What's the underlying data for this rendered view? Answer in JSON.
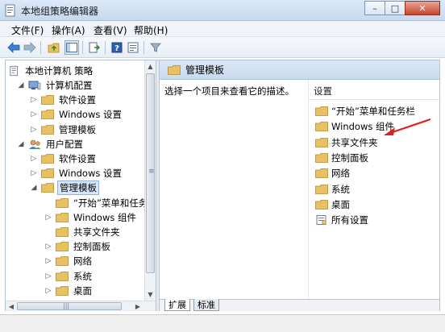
{
  "window": {
    "title": "本地组策略编辑器",
    "minimize": "–",
    "maximize": "□",
    "close": "✕"
  },
  "menu": [
    {
      "label": "文件(F)"
    },
    {
      "label": "操作(A)"
    },
    {
      "label": "查看(V)"
    },
    {
      "label": "帮助(H)"
    }
  ],
  "toolbar": {
    "items": [
      "back-arrow-icon",
      "forward-arrow-icon",
      "up-folder-icon",
      "show-hide-tree-icon",
      "export-list-icon",
      "help-icon",
      "properties-icon",
      "filter-icon"
    ]
  },
  "tree": {
    "root": "本地计算机 策略",
    "nodes": [
      {
        "label": "计算机配置",
        "depth": 1,
        "expander": "◢",
        "icon": "computer-icon"
      },
      {
        "label": "软件设置",
        "depth": 2,
        "expander": "▷",
        "icon": "folder-icon"
      },
      {
        "label": "Windows 设置",
        "depth": 2,
        "expander": "▷",
        "icon": "folder-icon"
      },
      {
        "label": "管理模板",
        "depth": 2,
        "expander": "▷",
        "icon": "folder-icon"
      },
      {
        "label": "用户配置",
        "depth": 1,
        "expander": "◢",
        "icon": "user-icon"
      },
      {
        "label": "软件设置",
        "depth": 2,
        "expander": "▷",
        "icon": "folder-icon"
      },
      {
        "label": "Windows 设置",
        "depth": 2,
        "expander": "▷",
        "icon": "folder-icon"
      },
      {
        "label": "管理模板",
        "depth": 2,
        "expander": "◢",
        "icon": "folder-icon",
        "selected": true
      },
      {
        "label": "“开始”菜单和任务",
        "depth": 3,
        "expander": "",
        "icon": "folder-icon"
      },
      {
        "label": "Windows 组件",
        "depth": 3,
        "expander": "▷",
        "icon": "folder-icon"
      },
      {
        "label": "共享文件夹",
        "depth": 3,
        "expander": "",
        "icon": "folder-icon"
      },
      {
        "label": "控制面板",
        "depth": 3,
        "expander": "▷",
        "icon": "folder-icon"
      },
      {
        "label": "网络",
        "depth": 3,
        "expander": "▷",
        "icon": "folder-icon"
      },
      {
        "label": "系统",
        "depth": 3,
        "expander": "▷",
        "icon": "folder-icon"
      },
      {
        "label": "桌面",
        "depth": 3,
        "expander": "▷",
        "icon": "folder-icon"
      }
    ]
  },
  "scroll": {
    "up": "▲",
    "down": "▼",
    "left": "◀",
    "right": "▶",
    "grip": "≡",
    "hgrip": "|||"
  },
  "detail": {
    "header": "管理模板",
    "description": "选择一个项目来查看它的描述。",
    "column": "设置",
    "items": [
      {
        "label": "“开始”菜单和任务栏",
        "icon": "folder-icon"
      },
      {
        "label": "Windows 组件",
        "icon": "folder-icon"
      },
      {
        "label": "共享文件夹",
        "icon": "folder-icon"
      },
      {
        "label": "控制面板",
        "icon": "folder-icon"
      },
      {
        "label": "网络",
        "icon": "folder-icon"
      },
      {
        "label": "系统",
        "icon": "folder-icon"
      },
      {
        "label": "桌面",
        "icon": "folder-icon"
      },
      {
        "label": "所有设置",
        "icon": "all-settings-icon"
      }
    ]
  },
  "tabs": [
    {
      "label": "扩展",
      "active": true
    },
    {
      "label": "标准",
      "active": false
    }
  ],
  "colors": {
    "folder": "#e9c163",
    "selection": "#d7e6f8",
    "arrow_annotation": "#e02020"
  }
}
